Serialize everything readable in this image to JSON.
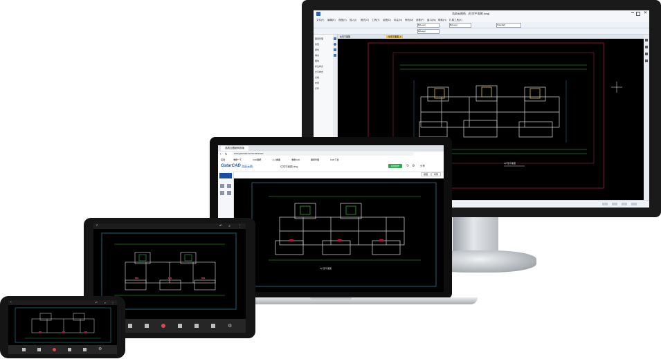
{
  "desktop": {
    "window_title": "浩辰云图纸 - [住宅平面图.dwg]",
    "menu_items": [
      "文件(F)",
      "编辑(E)",
      "视图(V)",
      "插入(I)",
      "格式(O)",
      "工具(T)",
      "绘图(D)",
      "标注(N)",
      "修改(M)",
      "参数(P)",
      "窗口(W)",
      "帮助(H)",
      "扩展工具(X)"
    ],
    "layer_combo": "ByLayer",
    "linetype_combo": "ByLayer",
    "lineweight_combo": "ByLayer",
    "style_combo": "Standard",
    "drawing_tab_left": "住宅平面图",
    "drawing_tab_right": "住宅平面图_1",
    "plan_caption": "A户型平面图",
    "sidebar_items": [
      "图层管理",
      "线型",
      "颜色",
      "填充",
      "图块",
      "标注样式",
      "文字样式",
      "表格",
      "布局",
      "打印"
    ]
  },
  "laptop": {
    "browser_tab": "浩辰云图纸网页版",
    "address": "www.gstarcad.com/cloud/viewer",
    "bookmarks": [
      "应用",
      "浩辰一下",
      "CAD图纸",
      "人人看图",
      "浩辰CAD",
      "图纸管理",
      "CAD下载"
    ],
    "brand": "GstarCAD",
    "brand_suffix": "浩辰云图",
    "file_title": "住宅平面图.dwg",
    "primary_button": "在线协作",
    "share_button": "分享",
    "tab_1": "模型",
    "tab_2": "布局",
    "plan_caption": "A户型平面图"
  },
  "tablet": {
    "plan_caption": ""
  },
  "phone": {
    "plan_caption": ""
  },
  "colors": {
    "cad_background": "#000000",
    "wall_white": "#dcdcdc",
    "dimension_green": "#2fbf3a",
    "axis_red": "#b4143c",
    "highlight_yellow": "#d6c431",
    "cyan_grid": "#2fa6b8",
    "ui_chrome": "#e8edf4"
  }
}
